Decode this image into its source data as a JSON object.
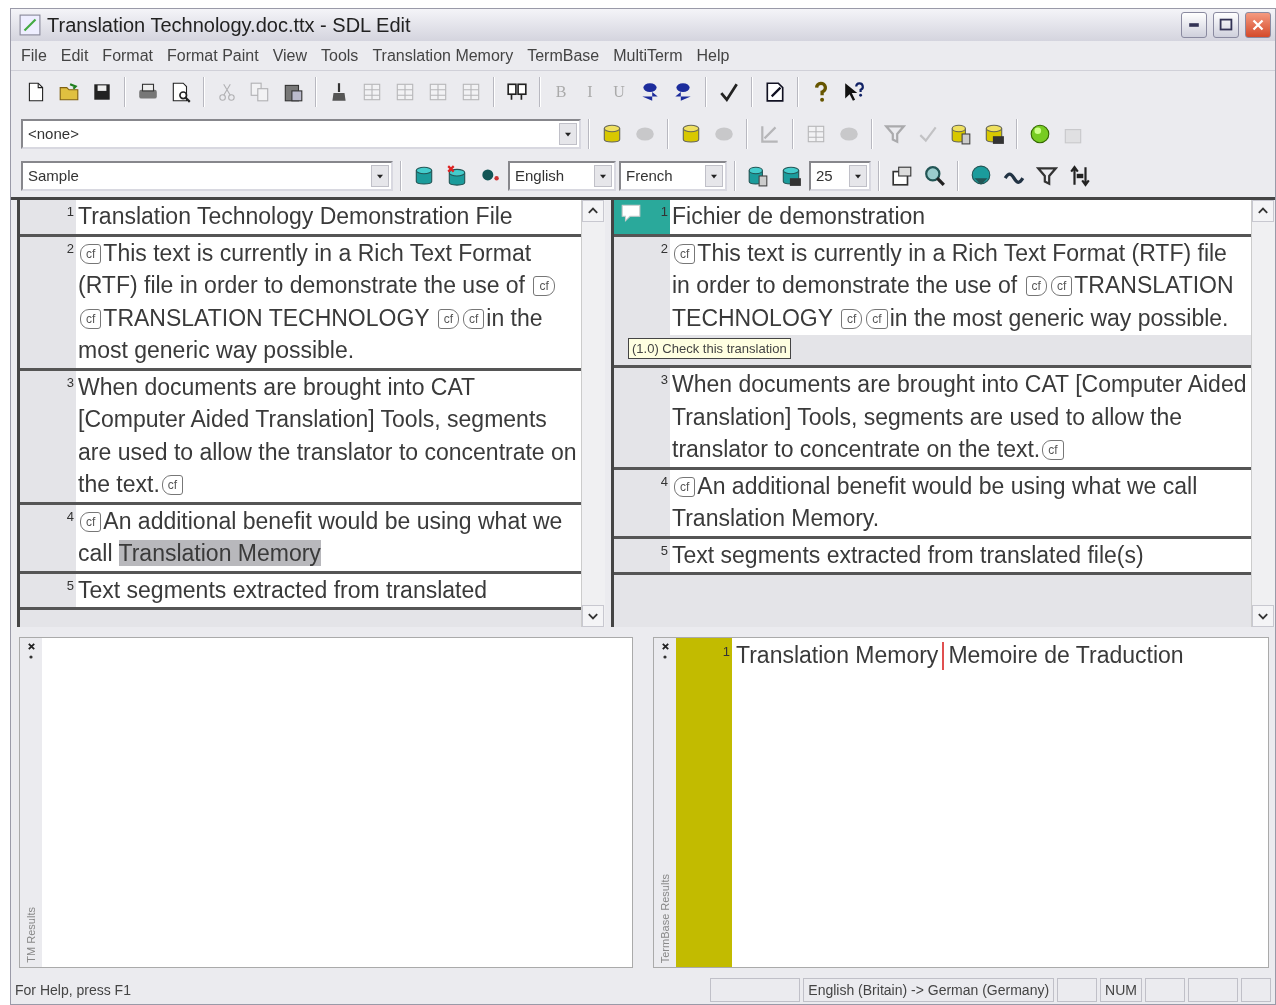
{
  "window": {
    "title": "Translation Technology.doc.ttx - SDL Edit"
  },
  "menu": [
    "File",
    "Edit",
    "Format",
    "Format Paint",
    "View",
    "Tools",
    "Translation Memory",
    "TermBase",
    "MultiTerm",
    "Help"
  ],
  "toolbars": [
    {
      "items": [
        {
          "kind": "button",
          "disabled": false
        },
        {
          "kind": "button",
          "disabled": false
        },
        {
          "kind": "button",
          "disabled": false
        },
        {
          "kind": "separator"
        },
        {
          "kind": "button",
          "disabled": false
        },
        {
          "kind": "button",
          "disabled": false
        },
        {
          "kind": "separator"
        },
        {
          "kind": "button",
          "disabled": true
        },
        {
          "kind": "button",
          "disabled": true
        },
        {
          "kind": "button",
          "disabled": false
        },
        {
          "kind": "separator"
        },
        {
          "kind": "button",
          "disabled": false
        },
        {
          "kind": "button",
          "disabled": true
        },
        {
          "kind": "button",
          "disabled": true
        },
        {
          "kind": "button",
          "disabled": true
        },
        {
          "kind": "button",
          "disabled": true
        },
        {
          "kind": "separator"
        },
        {
          "kind": "button",
          "disabled": false
        },
        {
          "kind": "separator"
        },
        {
          "kind": "letter",
          "label": "B",
          "disabled": true
        },
        {
          "kind": "letter",
          "label": "I",
          "disabled": true
        },
        {
          "kind": "letter",
          "label": "U",
          "disabled": true
        },
        {
          "kind": "button",
          "disabled": false
        },
        {
          "kind": "button",
          "disabled": false
        },
        {
          "kind": "separator"
        },
        {
          "kind": "button",
          "disabled": false
        },
        {
          "kind": "separator"
        },
        {
          "kind": "button",
          "disabled": false
        },
        {
          "kind": "separator"
        },
        {
          "kind": "button",
          "disabled": false
        },
        {
          "kind": "button",
          "disabled": false
        }
      ]
    },
    {
      "items": [
        {
          "kind": "combo",
          "value": "<none>"
        },
        {
          "kind": "separator"
        },
        {
          "kind": "button",
          "disabled": false
        },
        {
          "kind": "button",
          "disabled": true
        },
        {
          "kind": "separator"
        },
        {
          "kind": "button",
          "disabled": false
        },
        {
          "kind": "button",
          "disabled": true
        },
        {
          "kind": "separator"
        },
        {
          "kind": "button",
          "disabled": true
        },
        {
          "kind": "separator"
        },
        {
          "kind": "button",
          "disabled": true
        },
        {
          "kind": "button",
          "disabled": true
        },
        {
          "kind": "separator"
        },
        {
          "kind": "button",
          "disabled": true
        },
        {
          "kind": "button",
          "disabled": true
        },
        {
          "kind": "button",
          "disabled": false
        },
        {
          "kind": "button",
          "disabled": false
        },
        {
          "kind": "separator"
        },
        {
          "kind": "button",
          "disabled": false
        },
        {
          "kind": "button",
          "disabled": true
        }
      ]
    },
    {
      "items": [
        {
          "kind": "combo",
          "value": "Sample"
        },
        {
          "kind": "separator"
        },
        {
          "kind": "button",
          "disabled": false
        },
        {
          "kind": "button",
          "disabled": false
        },
        {
          "kind": "button",
          "disabled": false
        },
        {
          "kind": "combo",
          "value": "English"
        },
        {
          "kind": "combo",
          "value": "French"
        },
        {
          "kind": "separator"
        },
        {
          "kind": "button",
          "disabled": false
        },
        {
          "kind": "button",
          "disabled": false
        },
        {
          "kind": "combo",
          "value": "25"
        },
        {
          "kind": "separator"
        },
        {
          "kind": "button",
          "disabled": false
        },
        {
          "kind": "button",
          "disabled": false
        },
        {
          "kind": "separator"
        },
        {
          "kind": "button",
          "disabled": false
        },
        {
          "kind": "button",
          "disabled": false
        },
        {
          "kind": "button",
          "disabled": false
        },
        {
          "kind": "button",
          "disabled": false
        }
      ]
    }
  ],
  "source_segments": [
    {
      "number": "1",
      "parts": [
        {
          "kind": "text",
          "text": "Translation Technology Demonstration File"
        }
      ]
    },
    {
      "number": "2",
      "parts": [
        {
          "kind": "tag-open",
          "text": "cf"
        },
        {
          "kind": "text",
          "text": "This text is currently in a Rich Text Format (RTF) file in order to demonstrate the use of "
        },
        {
          "kind": "tag-close",
          "text": "cf"
        },
        {
          "kind": "tag-open",
          "text": "cf"
        },
        {
          "kind": "text",
          "text": "TRANSLATION TECHNOLOGY "
        },
        {
          "kind": "tag-close",
          "text": "cf"
        },
        {
          "kind": "tag-open",
          "text": "cf"
        },
        {
          "kind": "text",
          "text": "in the most generic way possible."
        }
      ]
    },
    {
      "number": "3",
      "parts": [
        {
          "kind": "text",
          "text": "When documents are brought into CAT [Computer Aided Translation] Tools, segments are used to allow the translator to concentrate on the text."
        },
        {
          "kind": "tag-open",
          "text": "cf"
        }
      ]
    },
    {
      "number": "4",
      "parts": [
        {
          "kind": "tag-open",
          "text": "cf"
        },
        {
          "kind": "text",
          "text": "An additional benefit would be using what we call "
        },
        {
          "kind": "highlight",
          "text": "Translation Memory"
        }
      ]
    },
    {
      "number": "5",
      "parts": [
        {
          "kind": "text",
          "text": "Text segments extracted from translated"
        }
      ]
    }
  ],
  "target_segments": [
    {
      "number": "1",
      "selected": true,
      "parts": [
        {
          "kind": "text",
          "text": "Fichier de demonstration"
        }
      ]
    },
    {
      "number": "2",
      "selected": false,
      "parts": [
        {
          "kind": "tag-open",
          "text": "cf"
        },
        {
          "kind": "text",
          "text": "This text is currently in a Rich Text Format (RTF) file in order to demonstrate the use of "
        },
        {
          "kind": "tag-close",
          "text": "cf"
        },
        {
          "kind": "tag-open",
          "text": "cf"
        },
        {
          "kind": "text",
          "text": "TRANSLATION TECHNOLOGY "
        },
        {
          "kind": "tag-close",
          "text": "cf"
        },
        {
          "kind": "tag-open",
          "text": "cf"
        },
        {
          "kind": "text",
          "text": "in the most generic way possible."
        }
      ]
    },
    {
      "number": "3",
      "selected": false,
      "parts": [
        {
          "kind": "text",
          "text": "When documents are brought into CAT [Computer Aided Translation] Tools, segments are used to allow the translator to concentrate on the text."
        },
        {
          "kind": "tag-open",
          "text": "cf"
        }
      ]
    },
    {
      "number": "4",
      "selected": false,
      "parts": [
        {
          "kind": "tag-open",
          "text": "cf"
        },
        {
          "kind": "text",
          "text": "An additional benefit would be using what we call Translation Memory."
        }
      ]
    },
    {
      "number": "5",
      "selected": false,
      "parts": [
        {
          "kind": "text",
          "text": "Text segments extracted from translated file(s)"
        }
      ]
    }
  ],
  "tooltip": "(1.0) Check this translation",
  "tm_results": {
    "title": "TM Results"
  },
  "termbase_results": {
    "title": "TermBase Results",
    "entries": [
      {
        "number": "1",
        "source": "Translation Memory",
        "target": "Memoire de Traduction"
      }
    ]
  },
  "status_bar": {
    "help": "For Help, press F1",
    "languages": "English (Britain) -> German (Germany)",
    "indicator": "NUM"
  }
}
